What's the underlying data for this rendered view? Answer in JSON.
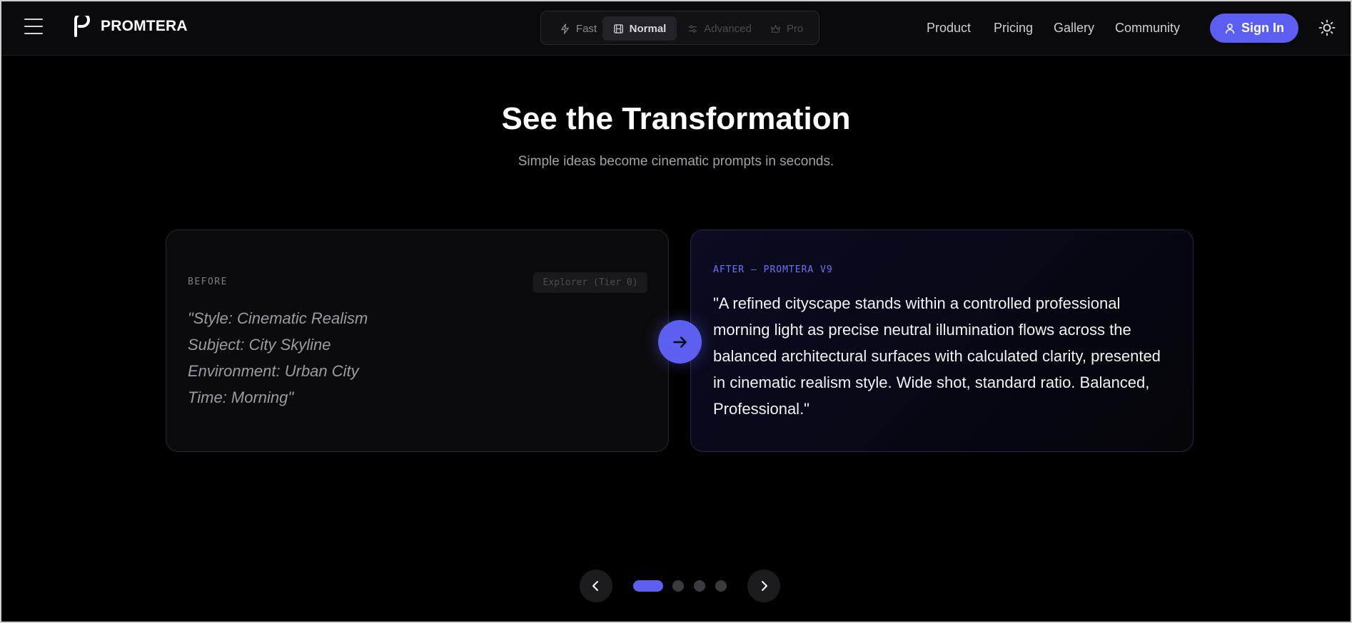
{
  "brand": {
    "name": "PROMTERA"
  },
  "modes": [
    {
      "label": "Fast",
      "icon": "bolt-icon",
      "state": "available"
    },
    {
      "label": "Normal",
      "icon": "film-icon",
      "state": "selected"
    },
    {
      "label": "Advanced",
      "icon": "sliders-icon",
      "state": "disabled"
    },
    {
      "label": "Pro",
      "icon": "crown-icon",
      "state": "disabled"
    }
  ],
  "nav": {
    "links": [
      "Product",
      "Pricing",
      "Gallery",
      "Community"
    ],
    "signin_label": "Sign In"
  },
  "hero": {
    "title": "See the Transformation",
    "subtitle": "Simple ideas become cinematic prompts in seconds."
  },
  "before": {
    "label": "BEFORE",
    "badge": "Explorer (Tier 0)",
    "lines": [
      "\"Style: Cinematic Realism",
      "Subject: City Skyline",
      "Environment: Urban City",
      "Time: Morning\""
    ]
  },
  "after": {
    "label": "AFTER — PROMTERA V9",
    "text": "\"A refined cityscape stands within a controlled professional morning light as precise neutral illumination flows across the balanced architectural surfaces with calculated clarity, presented in cinematic realism style. Wide shot, standard ratio. Balanced, Professional.\""
  },
  "carousel": {
    "slide_count": 4,
    "active_index": 0
  },
  "colors": {
    "accent": "#5b5ef1",
    "background": "#000000",
    "nav_bg": "#0a0a0c"
  }
}
